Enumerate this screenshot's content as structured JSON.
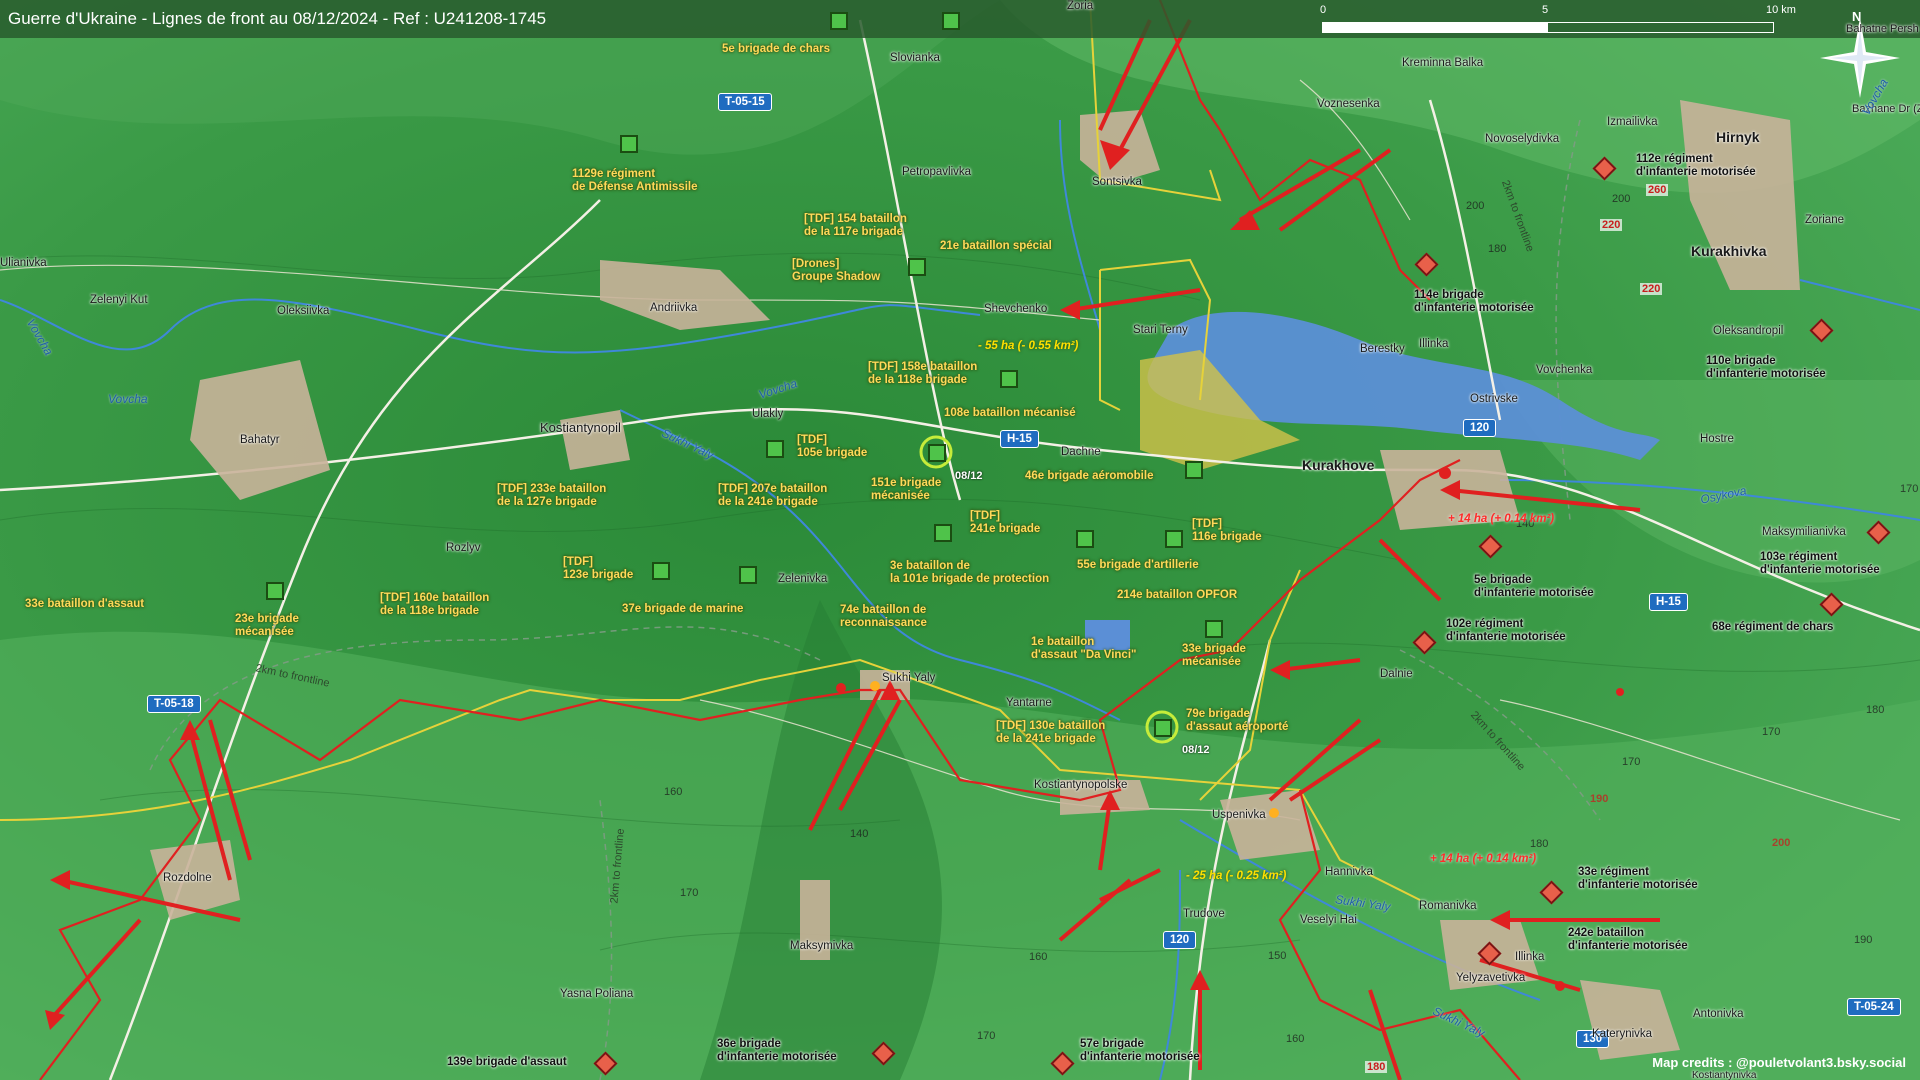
{
  "title": "Guerre d'Ukraine - Lignes de front au 08/12/2024 - Ref : U241208-1745",
  "scale": {
    "labels": [
      "0",
      "5",
      "10 km"
    ]
  },
  "compass": {
    "label": "N"
  },
  "credit": "Map credits : @pouletvolant3.bsky.social",
  "roads": [
    {
      "label": "T-05-15"
    },
    {
      "label": "H-15"
    },
    {
      "label": "H-15"
    },
    {
      "label": "T-05-18"
    },
    {
      "label": "T-05-24"
    },
    {
      "label": "120"
    },
    {
      "label": "120"
    },
    {
      "label": "130"
    }
  ],
  "road_numbers": [
    "260",
    "220",
    "220",
    "180"
  ],
  "towns": [
    "Zoria",
    "Slovianka",
    "Petropavlivka",
    "Sontsivka",
    "Kreminna Balka",
    "Voznesenka",
    "Izmailivka",
    "Novoselydivka",
    "Hirnyk",
    "Zoriane",
    "Kurakhivka",
    "Oleksandropil",
    "Bahatne Persh (Zhelanne Pers)",
    "Bazhane Dr (Zhelanne Dr)",
    "Ulianivka",
    "Zelenyi Kut",
    "Oleksiivka",
    "Andriivka",
    "Shevchenko",
    "Stari Terny",
    "Berestky",
    "Illinka",
    "Vovchenka",
    "Ostrivske",
    "Hostre",
    "Kostiantynopil",
    "Ulakly",
    "Dachne",
    "Kurakhove",
    "Bahatyr",
    "Rozlyv",
    "Zelenivka",
    "Sukhi Yaly",
    "Yantarne",
    "Dalnie",
    "Kostiantynopolske",
    "Uspenivka",
    "Hannivka",
    "Veselyi Hai",
    "Trudove",
    "Romanivka",
    "Illinka",
    "Yelyzavetivka",
    "Katerynivka",
    "Antonivka",
    "Maksymivka",
    "Yasna Poliana",
    "Rozdolne",
    "Maksymilianivka",
    "Kostiantynivka"
  ],
  "rivers": [
    "Vovcha",
    "Vovcha",
    "Vovcha",
    "Sukhi Yaly",
    "Sukhi Yaly",
    "Sukhi Yaly",
    "Osykova",
    "Vovcha"
  ],
  "kontlines": [
    "2km to frontline",
    "2km to frontline",
    "2km to frontline",
    "2km to frontline"
  ],
  "altitudes": [
    "200",
    "180",
    "170",
    "160",
    "140",
    "170",
    "170",
    "160",
    "150",
    "180",
    "190",
    "170",
    "140",
    "160",
    "170",
    "180",
    "190",
    "200",
    "200"
  ],
  "units_ua": [
    "5e brigade de chars",
    "1129e régiment\nde Défense Antimissile",
    "[TDF] 154 bataillon\nde la 117e brigade",
    "21e bataillon spécial",
    "[Drones]\nGroupe Shadow",
    "[TDF] 158e bataillon\nde la 118e brigade",
    "108e bataillon mécanisé",
    "[TDF]\n105e brigade",
    "46e brigade aéromobile",
    "151e brigade\nmécanisée",
    "[TDF] 233e bataillon\nde la 127e brigade",
    "[TDF] 207e bataillon\nde la 241e brigade",
    "[TDF]\n241e brigade",
    "[TDF]\n116e brigade",
    "[TDF]\n123e brigade",
    "3e bataillon de\nla 101e brigade de protection",
    "55e brigade d'artillerie",
    "33e bataillon d'assaut",
    "23e brigade\nmécanisée",
    "[TDF] 160e bataillon\nde la 118e brigade",
    "37e brigade de marine",
    "214e bataillon OPFOR",
    "74e bataillon de\nreconnaissance",
    "1e bataillon\nd'assaut \"Da Vinci\"",
    "33e brigade\nmécanisée",
    "79e brigade\nd'assaut aéroporté",
    "[TDF] 130e bataillon\nde la 241e brigade"
  ],
  "units_ru": [
    "112e régiment\nd'infanterie motorisée",
    "114e brigade\nd'infanterie motorisée",
    "110e brigade\nd'infanterie motorisée",
    "5e brigade\nd'infanterie motorisée",
    "103e régiment\nd'infanterie motorisée",
    "102e régiment\nd'infanterie motorisée",
    "68e régiment de chars",
    "33e régiment\nd'infanterie motorisée",
    "242e bataillon\nd'infanterie motorisée",
    "36e brigade\nd'infanterie motorisée",
    "57e brigade\nd'infanterie motorisée",
    "139e brigade d'assaut"
  ],
  "gains": [
    "- 55 ha (- 0.55 km²)",
    "+ 14 ha (+ 0.14 km²)",
    "- 25 ha (- 0.25 km²)",
    "+ 14 ha (+ 0.14 km²)"
  ],
  "dates": [
    "08/12",
    "08/12"
  ],
  "colors": {
    "terrain": "#2f8a3a",
    "frontline_ru": "#e02020",
    "frontline_ua": "#e6d23a",
    "water": "#5b8fd6",
    "town_fill": "#c9b39a"
  }
}
